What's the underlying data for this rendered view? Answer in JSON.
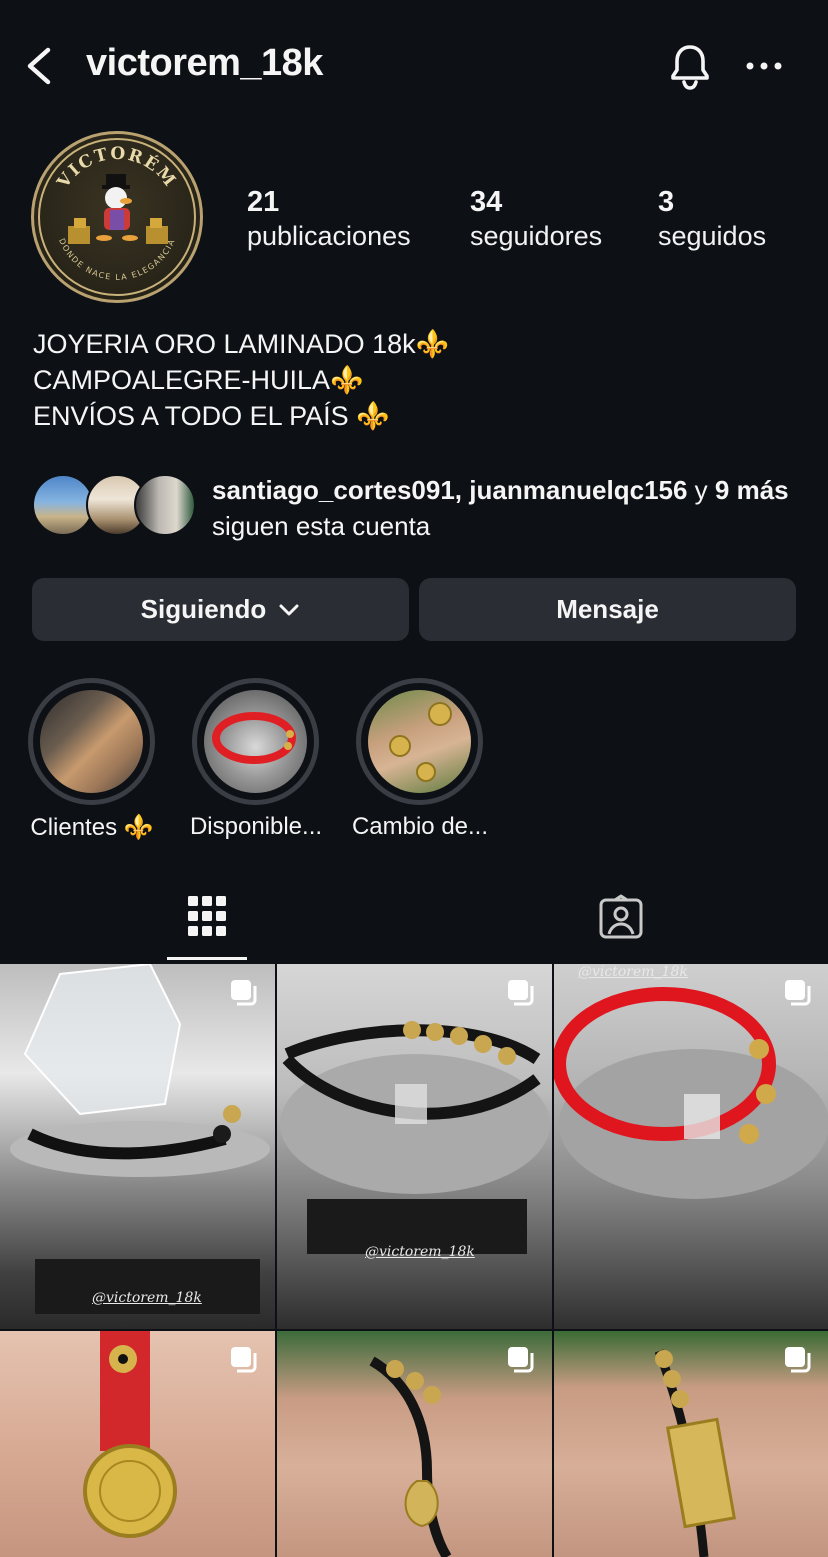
{
  "header": {
    "title": "victorem_18k",
    "back_icon": "chevron-left-icon",
    "notify_icon": "bell-icon",
    "more_icon": "more-horizontal-icon"
  },
  "avatar": {
    "brand_text": "VICTORÉM",
    "tagline": "DONDE NACE LA ELEGANCIA"
  },
  "stats": [
    {
      "value": "21",
      "label": "publicaciones"
    },
    {
      "value": "34",
      "label": "seguidores"
    },
    {
      "value": "3",
      "label": "seguidos"
    }
  ],
  "bio": {
    "line1": "JOYERIA ORO LAMINADO 18k",
    "line2": "CAMPOALEGRE-HUILA",
    "line3": "ENVÍOS A TODO EL PAÍS ",
    "emoji": "⚜️"
  },
  "followed_by": {
    "user1": "santiago_cortes091",
    "comma": ", ",
    "user2": "juanmanuelqc156",
    "and": " y ",
    "more": "9 más",
    "suffix": " siguen esta cuenta"
  },
  "actions": {
    "following_label": "Siguiendo",
    "message_label": "Mensaje"
  },
  "highlights": [
    {
      "label": "Clientes ⚜️"
    },
    {
      "label": "Disponible..."
    },
    {
      "label": "Cambio de..."
    }
  ],
  "tabs": {
    "grid_icon": "grid-icon",
    "tagged_icon": "tagged-person-icon"
  },
  "posts": {
    "watermark": "@victorem_18k",
    "multi_icon": "multiple-images-icon"
  },
  "colors": {
    "background": "#0d1015",
    "button": "#2a2d33",
    "accent_gold": "#d4a83a"
  }
}
